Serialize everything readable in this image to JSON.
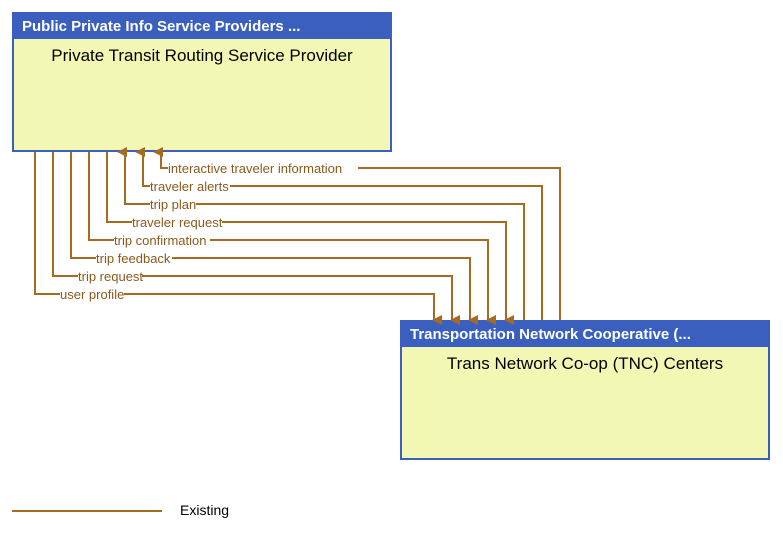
{
  "topBox": {
    "header": "Public Private Info Service Providers ...",
    "title": "Private Transit Routing Service Provider"
  },
  "bottomBox": {
    "header": "Transportation Network Cooperative (...",
    "title": "Trans Network Co-op (TNC) Centers"
  },
  "flows": {
    "f1": "interactive traveler information",
    "f2": "traveler alerts",
    "f3": "trip plan",
    "f4": "traveler request",
    "f5": "trip confirmation",
    "f6": "trip feedback",
    "f7": "trip request",
    "f8": "user profile"
  },
  "legend": {
    "existing": "Existing"
  }
}
